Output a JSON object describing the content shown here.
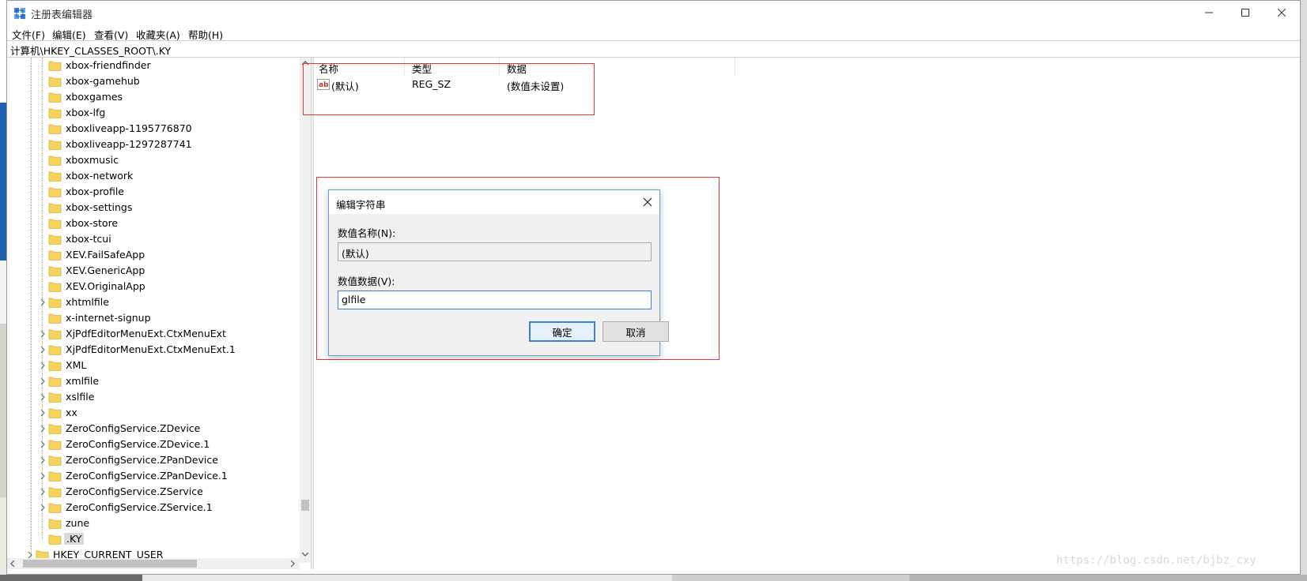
{
  "window": {
    "title": "注册表编辑器",
    "menu": [
      "文件(F)",
      "编辑(E)",
      "查看(V)",
      "收藏夹(A)",
      "帮助(H)"
    ],
    "address": "计算机\\HKEY_CLASSES_ROOT\\.KY"
  },
  "tree": {
    "items": [
      {
        "label": "xbox-friendfinder",
        "expandable": false
      },
      {
        "label": "xbox-gamehub",
        "expandable": false
      },
      {
        "label": "xboxgames",
        "expandable": false
      },
      {
        "label": "xbox-lfg",
        "expandable": false
      },
      {
        "label": "xboxliveapp-1195776870",
        "expandable": false
      },
      {
        "label": "xboxliveapp-1297287741",
        "expandable": false
      },
      {
        "label": "xboxmusic",
        "expandable": false
      },
      {
        "label": "xbox-network",
        "expandable": false
      },
      {
        "label": "xbox-profile",
        "expandable": false
      },
      {
        "label": "xbox-settings",
        "expandable": false
      },
      {
        "label": "xbox-store",
        "expandable": false
      },
      {
        "label": "xbox-tcui",
        "expandable": false
      },
      {
        "label": "XEV.FailSafeApp",
        "expandable": false
      },
      {
        "label": "XEV.GenericApp",
        "expandable": false
      },
      {
        "label": "XEV.OriginalApp",
        "expandable": false
      },
      {
        "label": "xhtmlfile",
        "expandable": true
      },
      {
        "label": "x-internet-signup",
        "expandable": false
      },
      {
        "label": "XjPdfEditorMenuExt.CtxMenuExt",
        "expandable": true
      },
      {
        "label": "XjPdfEditorMenuExt.CtxMenuExt.1",
        "expandable": true
      },
      {
        "label": "XML",
        "expandable": true
      },
      {
        "label": "xmlfile",
        "expandable": true
      },
      {
        "label": "xslfile",
        "expandable": true
      },
      {
        "label": "xx",
        "expandable": true
      },
      {
        "label": "ZeroConfigService.ZDevice",
        "expandable": true
      },
      {
        "label": "ZeroConfigService.ZDevice.1",
        "expandable": true
      },
      {
        "label": "ZeroConfigService.ZPanDevice",
        "expandable": true
      },
      {
        "label": "ZeroConfigService.ZPanDevice.1",
        "expandable": true
      },
      {
        "label": "ZeroConfigService.ZService",
        "expandable": true
      },
      {
        "label": "ZeroConfigService.ZService.1",
        "expandable": true
      },
      {
        "label": "zune",
        "expandable": false
      },
      {
        "label": ".KY",
        "expandable": false,
        "selected": true
      }
    ],
    "next_root": "HKEY_CURRENT_USER"
  },
  "list": {
    "columns": [
      "名称",
      "类型",
      "数据"
    ],
    "rows": [
      {
        "name": "(默认)",
        "type": "REG_SZ",
        "data": "(数值未设置)"
      }
    ]
  },
  "dialog": {
    "title": "编辑字符串",
    "name_label": "数值名称(N):",
    "name_value": "(默认)",
    "data_label": "数值数据(V):",
    "data_value": "glfile",
    "ok_label": "确定",
    "cancel_label": "取消"
  },
  "watermark": "https://blog.csdn.net/bjbz_cxy",
  "colors": {
    "highlight_box": "#e8313b",
    "folder": "#f5d35c",
    "focus": "#3c7fd0"
  }
}
